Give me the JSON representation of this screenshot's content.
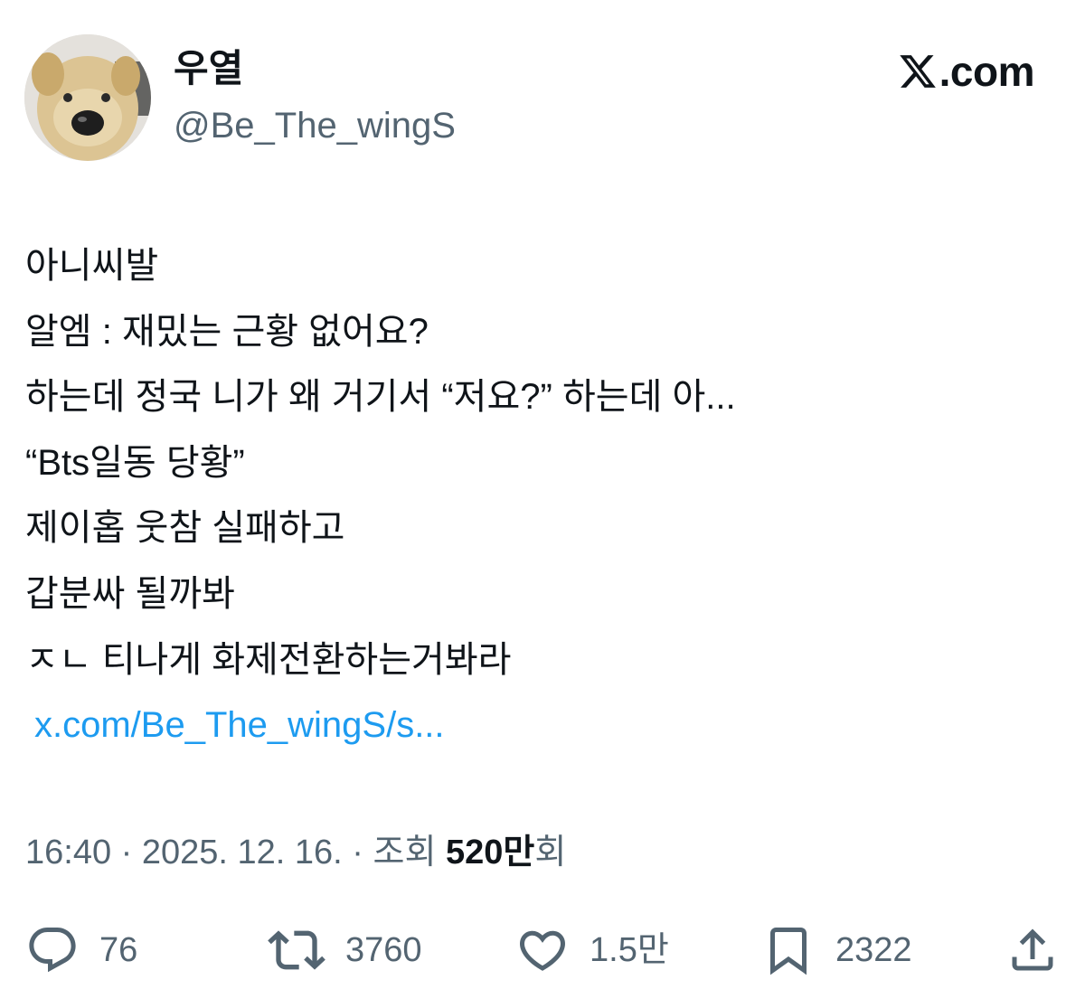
{
  "author": {
    "display_name": "우열",
    "handle": "@Be_The_wingS",
    "avatar_icon": "dog-bread-avatar"
  },
  "brand": {
    "label": ".com",
    "icon": "x-logo-icon"
  },
  "tweet": {
    "lines": [
      "아니씨발",
      "알엠 : 재밌는 근황 없어요?",
      "하는데 정국 니가 왜 거기서 “저요?” 하는데 아...",
      "“Bts일동 당황”",
      "제이홉 웃참 실패하고",
      "갑분싸 될까봐",
      "ㅈㄴ 티나게 화제전환하는거봐라"
    ],
    "link": "x.com/Be_The_wingS/s..."
  },
  "meta": {
    "time": "16:40",
    "separator": " · ",
    "date": "2025. 12. 16.",
    "views_label": "조회 ",
    "views_count": "520만",
    "views_suffix": "회"
  },
  "actions": {
    "reply": {
      "count": "76",
      "icon": "reply-bubble-icon"
    },
    "retweet": {
      "count": "3760",
      "icon": "retweet-icon"
    },
    "like": {
      "count": "1.5만",
      "icon": "heart-icon"
    },
    "bookmark": {
      "count": "2322",
      "icon": "bookmark-icon"
    },
    "share": {
      "icon": "share-upload-icon"
    }
  },
  "colors": {
    "text": "#0f1419",
    "secondary": "#536471",
    "link": "#1d9bf0",
    "background": "#ffffff"
  }
}
